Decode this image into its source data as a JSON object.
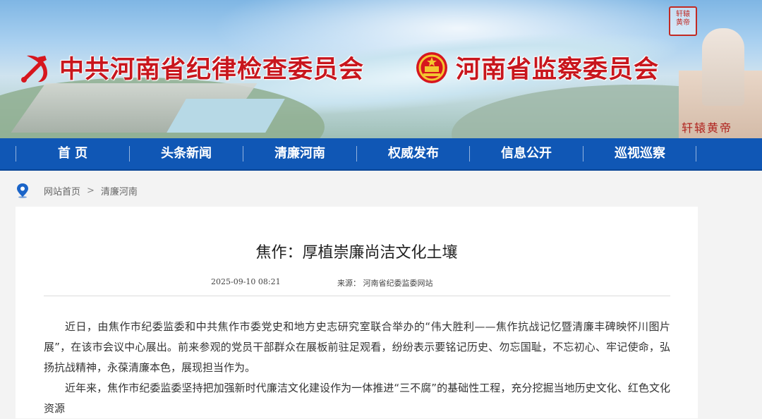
{
  "header": {
    "org1": "中共河南省纪律检查委员会",
    "org2": "河南省监察委员会",
    "seal_text": "轩辕黄帝",
    "statue_label": "轩辕黄帝"
  },
  "nav": {
    "items": [
      "首  页",
      "头条新闻",
      "清廉河南",
      "权威发布",
      "信息公开",
      "巡视巡察"
    ]
  },
  "breadcrumb": {
    "home": "网站首页",
    "separator": ">",
    "current": "清廉河南"
  },
  "article": {
    "title": "焦作：厚植崇廉尚洁文化土壤",
    "date": "2025-09-10 08:21",
    "source": "来源： 河南省纪委监委网站",
    "paragraphs": [
      "近日，由焦作市纪委监委和中共焦作市委党史和地方史志研究室联合举办的“伟大胜利——焦作抗战记忆暨清廉丰碑映怀川图片展”，在该市会议中心展出。前来参观的党员干部群众在展板前驻足观看，纷纷表示要铭记历史、勿忘国耻，不忘初心、牢记使命，弘扬抗战精神，永葆清廉本色，展现担当作为。",
      "近年来，焦作市纪委监委坚持把加强新时代廉洁文化建设作为一体推进“三不腐”的基础性工程，充分挖掘当地历史文化、红色文化资源"
    ]
  },
  "colors": {
    "nav_bg": "#1057b5",
    "title_red": "#c8161d"
  },
  "icons": [
    "party-emblem-icon",
    "national-emblem-icon",
    "location-pin-icon"
  ]
}
